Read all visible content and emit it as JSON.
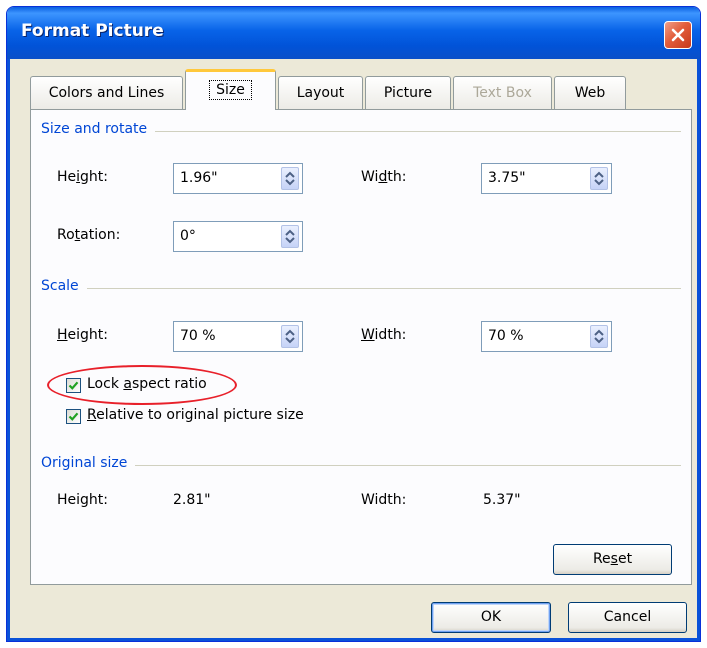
{
  "window": {
    "title": "Format Picture"
  },
  "tabs": [
    {
      "label": "Colors and Lines"
    },
    {
      "label": "Size"
    },
    {
      "label": "Layout"
    },
    {
      "label": "Picture"
    },
    {
      "label": "Text Box"
    },
    {
      "label": "Web"
    }
  ],
  "size_and_rotate": {
    "group_label": "Size and rotate",
    "height": {
      "label_pre": "He",
      "label_key": "i",
      "label_post": "ght:",
      "value": "1.96\""
    },
    "width": {
      "label_pre": "Wi",
      "label_key": "d",
      "label_post": "th:",
      "value": "3.75\""
    },
    "rotation": {
      "label_pre": "Ro",
      "label_key": "t",
      "label_post": "ation:",
      "value": "0°"
    }
  },
  "scale": {
    "group_label": "Scale",
    "height": {
      "label_key": "H",
      "label_post": "eight:",
      "value": "70 %"
    },
    "width": {
      "label_key": "W",
      "label_post": "idth:",
      "value": "70 %"
    },
    "lock_aspect": {
      "label_pre": "Lock ",
      "label_key": "a",
      "label_post": "spect ratio",
      "checked": true
    },
    "relative_original": {
      "label_key": "R",
      "label_post": "elative to original picture size",
      "checked": true
    }
  },
  "original_size": {
    "group_label": "Original size",
    "height_label": "Height:",
    "height_value": "2.81\"",
    "width_label": "Width:",
    "width_value": "5.37\""
  },
  "buttons": {
    "reset": {
      "label_pre": "Re",
      "label_key": "s",
      "label_post": "et"
    },
    "ok": "OK",
    "cancel": "Cancel"
  },
  "colors": {
    "title_bar": "#0a5fe0",
    "group_label": "#0046d5",
    "annotation": "#e8202a",
    "dialog_bg": "#ece9d8"
  }
}
